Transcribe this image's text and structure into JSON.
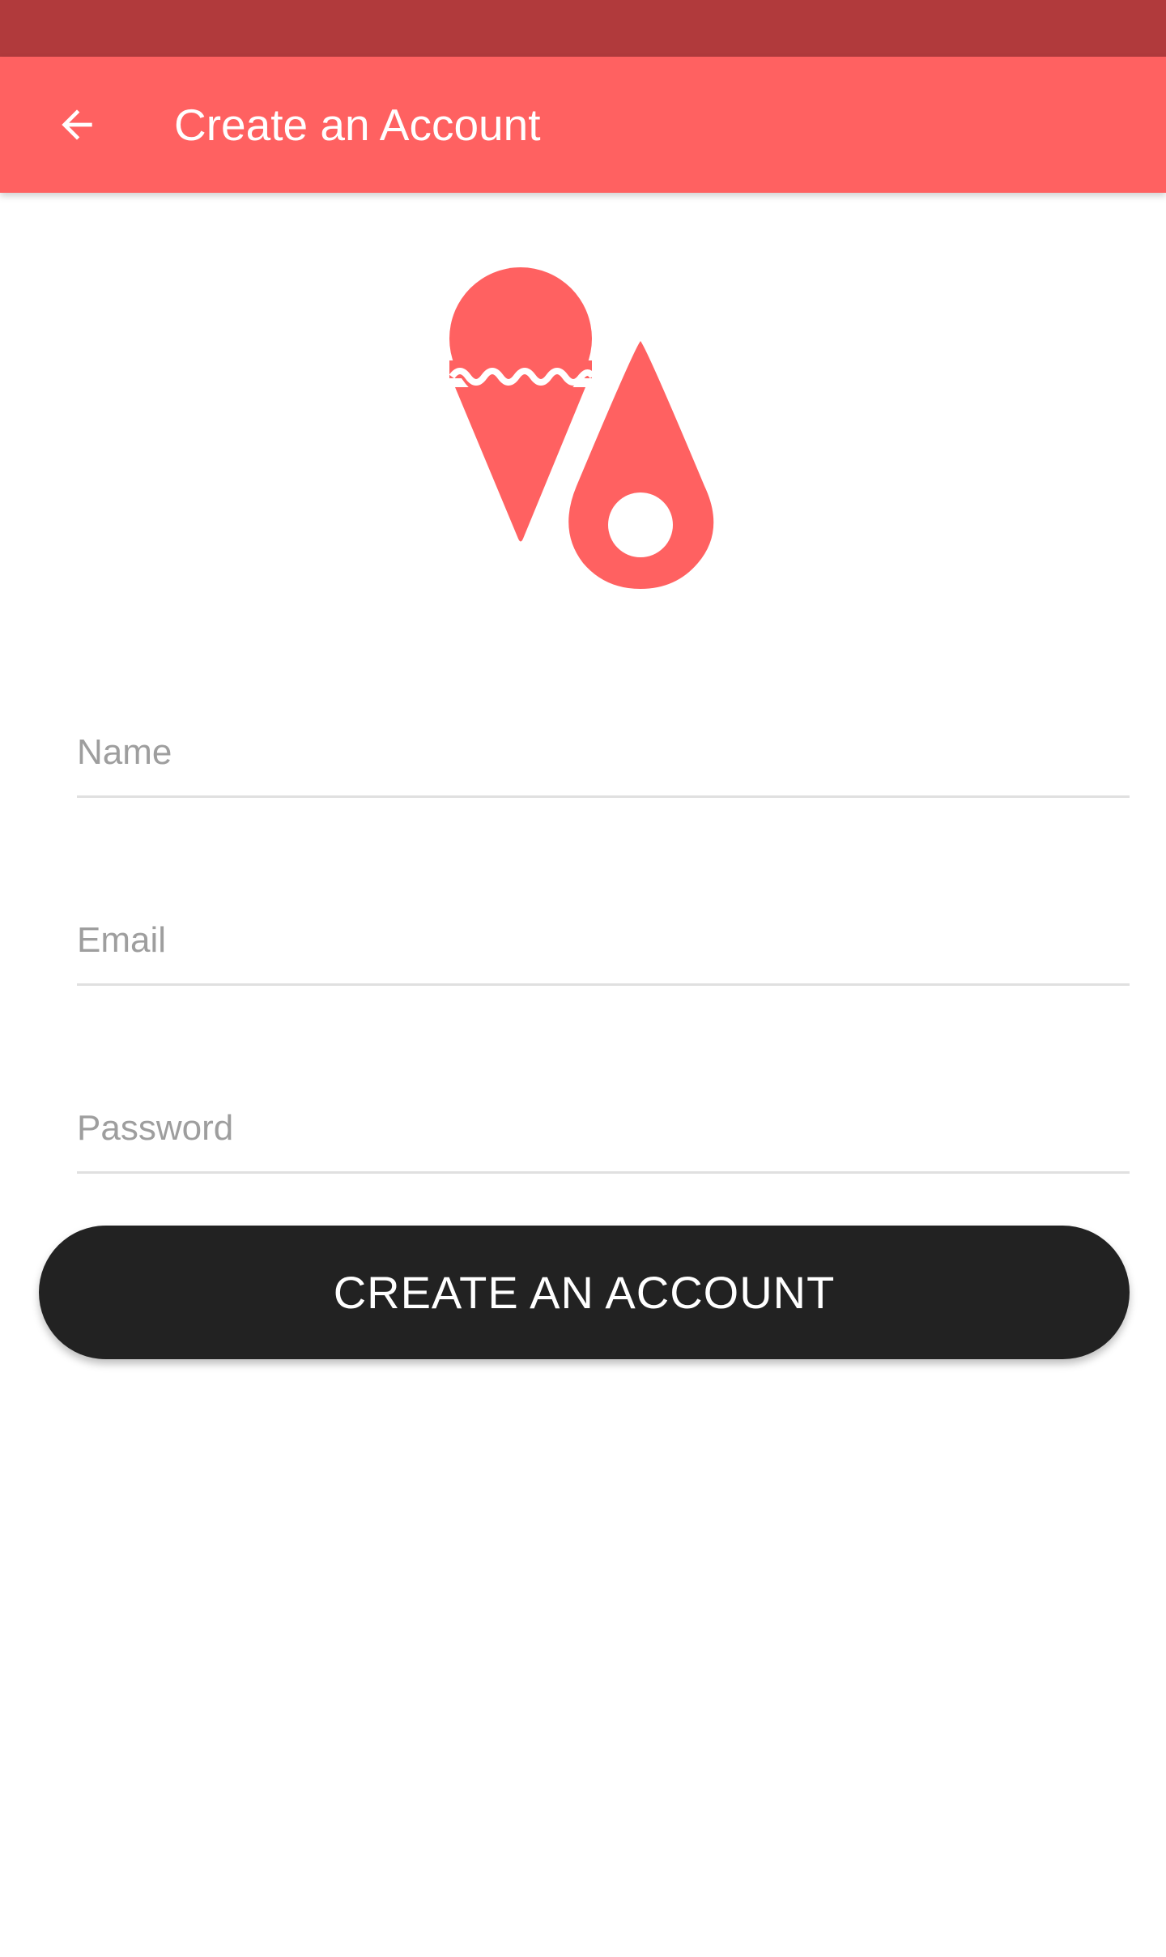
{
  "colors": {
    "status_bar": "#B13A3C",
    "app_bar": "#FF6161",
    "accent": "#FF6161",
    "button_bg": "#222222",
    "button_text": "#FFFFFF",
    "placeholder": "#9E9E9E",
    "divider": "#E0E0E0"
  },
  "header": {
    "back_icon": "arrow-left-icon",
    "title": "Create an Account"
  },
  "logo": {
    "icon": "ice-cream-location-icon"
  },
  "form": {
    "name_placeholder": "Name",
    "email_placeholder": "Email",
    "password_placeholder": "Password",
    "name_value": "",
    "email_value": "",
    "password_value": "",
    "submit_label": "CREATE AN ACCOUNT"
  }
}
